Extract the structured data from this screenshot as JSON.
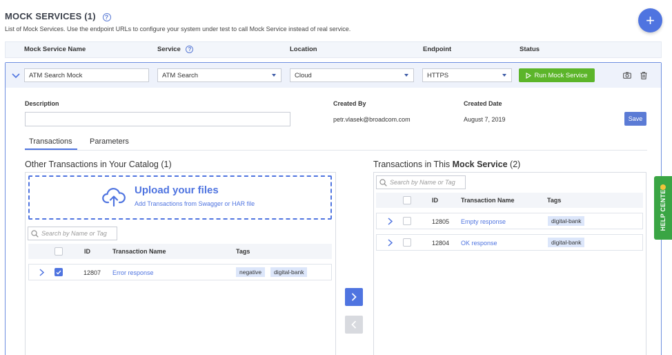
{
  "header": {
    "title": "MOCK SERVICES (1)",
    "help_icon": "question-circle-icon",
    "subtitle": "List of Mock Services. Use the endpoint URLs to configure your system under test to call Mock Service instead of real service.",
    "add_button_icon": "plus-icon"
  },
  "columns": {
    "name": "Mock Service Name",
    "service": "Service",
    "location": "Location",
    "endpoint": "Endpoint",
    "status": "Status"
  },
  "mock_service": {
    "name_value": "ATM Search Mock",
    "service_value": "ATM Search",
    "location_value": "Cloud",
    "endpoint_value": "HTTPS",
    "run_label": "Run Mock Service",
    "description_label": "Description",
    "description_value": "",
    "created_by_label": "Created By",
    "created_by_value": "petr.vlasek@broadcom.com",
    "created_date_label": "Created Date",
    "created_date_value": "August 7, 2019",
    "save_label": "Save"
  },
  "tabs": [
    {
      "label": "Transactions",
      "active": true
    },
    {
      "label": "Parameters",
      "active": false
    }
  ],
  "catalog": {
    "title": "Other Transactions in Your Catalog (1)",
    "upload_title": "Upload your files",
    "upload_subtitle": "Add Transactions from Swagger or HAR file",
    "search_placeholder": "Search by Name or Tag",
    "col_id": "ID",
    "col_name": "Transaction Name",
    "col_tags": "Tags",
    "rows": [
      {
        "id": "12807",
        "name": "Error response",
        "checked": true,
        "tags": [
          "negative",
          "digital-bank"
        ]
      }
    ]
  },
  "service_tx": {
    "title_prefix": "Transactions in This ",
    "title_bold": "Mock Service",
    "title_suffix": " (2)",
    "search_placeholder": "Search by Name or Tag",
    "col_id": "ID",
    "col_name": "Transaction Name",
    "col_tags": "Tags",
    "rows": [
      {
        "id": "12805",
        "name": "Empty response",
        "checked": false,
        "tags": [
          "digital-bank"
        ]
      },
      {
        "id": "12804",
        "name": "OK response",
        "checked": false,
        "tags": [
          "digital-bank"
        ]
      }
    ]
  },
  "help_center": {
    "label": "HELP CENTER"
  },
  "colors": {
    "accent": "#4f74e0",
    "run_green": "#5cb52a",
    "help_green": "#3aa544",
    "tag_bg": "#dce6fa"
  }
}
